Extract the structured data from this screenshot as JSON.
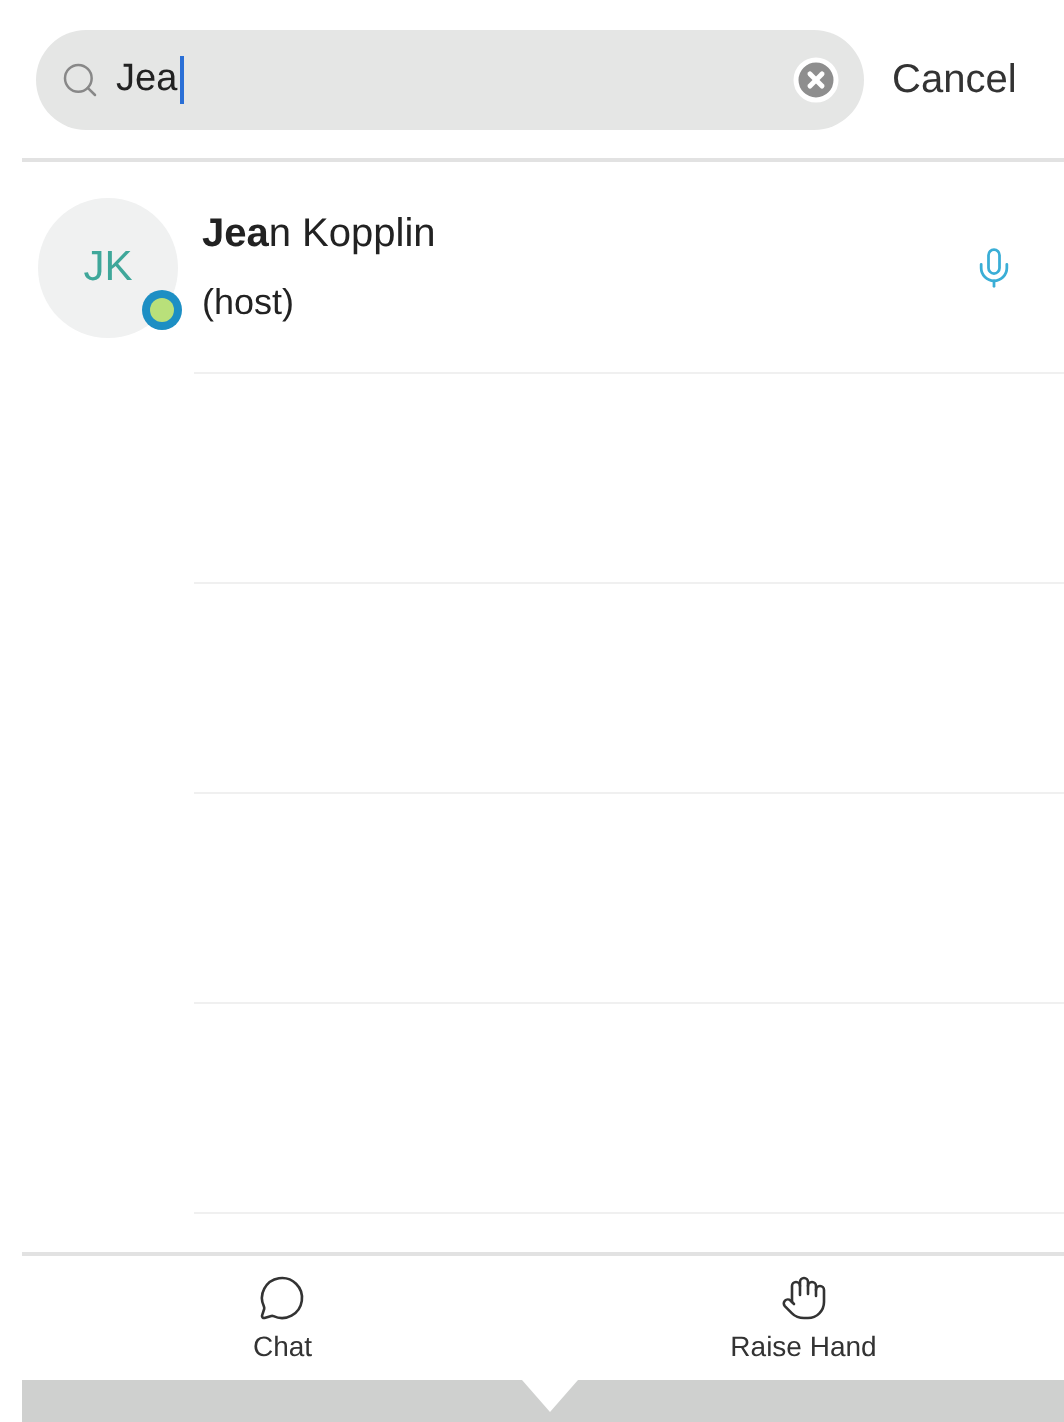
{
  "search": {
    "value": "Jea",
    "cancel": "Cancel"
  },
  "participants": [
    {
      "initials": "JK",
      "name": "**Jea**n Kopplin",
      "role": "(host)",
      "muted": false
    }
  ],
  "toolbar": [
    {
      "kind": "chat",
      "label": "Chat"
    },
    {
      "kind": "hand",
      "label": "Raise Hand"
    }
  ]
}
